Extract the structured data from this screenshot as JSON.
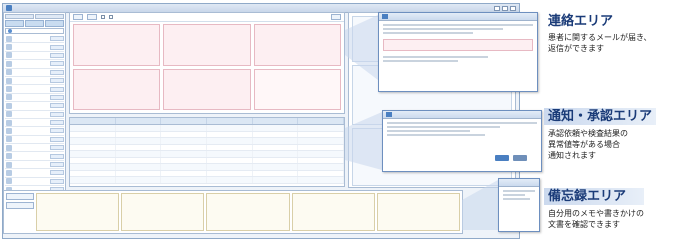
{
  "colors": {
    "accent": "#1a3b78",
    "callout_fill": "#cbd9ee",
    "card_pink": "#fdeff2",
    "alert_red": "#c0282d",
    "frame_blue": "#8fa9c8"
  },
  "callouts": [
    {
      "title": "連絡エリア",
      "description": "患者に関するメールが届き、\n返信ができます"
    },
    {
      "title": "通知・承認エリア",
      "description": "承認依頼や検査結果の\n異常値等がある場合\n通知されます"
    },
    {
      "title": "備忘録エリア",
      "description": "自分用のメモや書きかけの\n文書を確認できます"
    }
  ]
}
